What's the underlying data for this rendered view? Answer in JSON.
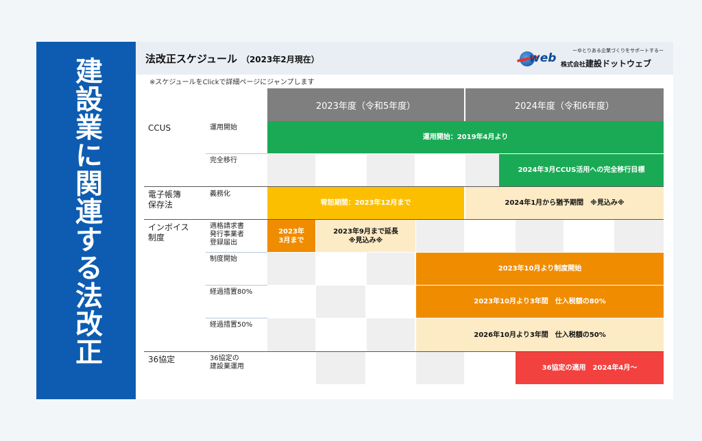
{
  "sidebar": {
    "title": "建設業に関連する法改正"
  },
  "header": {
    "title": "法改正スケジュール",
    "subtitle": "（2023年2月現在）",
    "logo_tagline": "ーゆとりある企業づくりをサポートするー",
    "logo_web": "web",
    "logo_company_prefix": "株式会社",
    "logo_company_name": "建設ドットウェブ"
  },
  "note": "※スケジュールをClickで詳細ページにジャンプします",
  "chart_data": {
    "type": "table",
    "columns": [
      "2023年度（令和5年度）",
      "2024年度（令和6年度）"
    ],
    "categories": [
      {
        "name": "CCUS",
        "rows": [
          {
            "label": "運用開始",
            "bars": [
              {
                "text": "運用開始：2019年4月より",
                "color": "#1aaa55"
              }
            ]
          },
          {
            "label": "完全移行",
            "bars": [
              {
                "text": "2024年3月CCUS活用への完全移行目標",
                "color": "#1aaa55"
              }
            ]
          }
        ]
      },
      {
        "name": "電子帳簿保存法",
        "rows": [
          {
            "label": "義務化",
            "bars": [
              {
                "text": "宥恕期間：2023年12月まで",
                "color": "#fcbf00"
              },
              {
                "text": "2024年1月から猶予期間　※見込み※",
                "color": "#fdebc6"
              }
            ]
          }
        ]
      },
      {
        "name": "インボイス制度",
        "rows": [
          {
            "label": "適格請求書発行事業者登録届出",
            "bars": [
              {
                "text": "2023年3月まで",
                "color": "#f08c00"
              },
              {
                "text": "2023年9月まで延長※見込み※",
                "color": "#fdebc6"
              }
            ]
          },
          {
            "label": "制度開始",
            "bars": [
              {
                "text": "2023年10月より制度開始",
                "color": "#f08c00"
              }
            ]
          },
          {
            "label": "経過措置80%",
            "bars": [
              {
                "text": "2023年10月より3年間　仕入税額の80%",
                "color": "#f08c00"
              }
            ]
          },
          {
            "label": "経過措置50%",
            "bars": [
              {
                "text": "2026年10月より3年間　仕入税額の50%",
                "color": "#fdebc6"
              }
            ]
          }
        ]
      },
      {
        "name": "36協定",
        "rows": [
          {
            "label": "36協定の建設業運用",
            "bars": [
              {
                "text": "36協定の適用　2024年4月～",
                "color": "#f2413e"
              }
            ]
          }
        ]
      }
    ]
  },
  "labels": {
    "cat_ccus": "CCUS",
    "cat_denshi_1": "電子帳簿",
    "cat_denshi_2": "保存法",
    "cat_invoice_1": "インボイス",
    "cat_invoice_2": "制度",
    "cat_36": "36協定",
    "sub_unyou": "運用開始",
    "sub_kanzen": "完全移行",
    "sub_gimu": "義務化",
    "sub_tekikaku_1": "適格請求書",
    "sub_tekikaku_2": "発行事業者",
    "sub_tekikaku_3": "登録届出",
    "sub_seido": "制度開始",
    "sub_80": "経過措置80%",
    "sub_50": "経過措置50%",
    "sub_36_1": "36協定の",
    "sub_36_2": "建設業運用",
    "bar_invoice_a_1": "2023年",
    "bar_invoice_a_2": "3月まで",
    "bar_invoice_b_1": "2023年9月まで延長",
    "bar_invoice_b_2": "※見込み※"
  },
  "colors": {
    "sidebar": "#0d5cb1",
    "header_bg": "#e9eef5",
    "year_header": "#7f7f7f",
    "green": "#1aaa55",
    "yellow": "#fcbf00",
    "orange": "#f08c00",
    "light": "#fdebc6",
    "red": "#f2413e"
  }
}
